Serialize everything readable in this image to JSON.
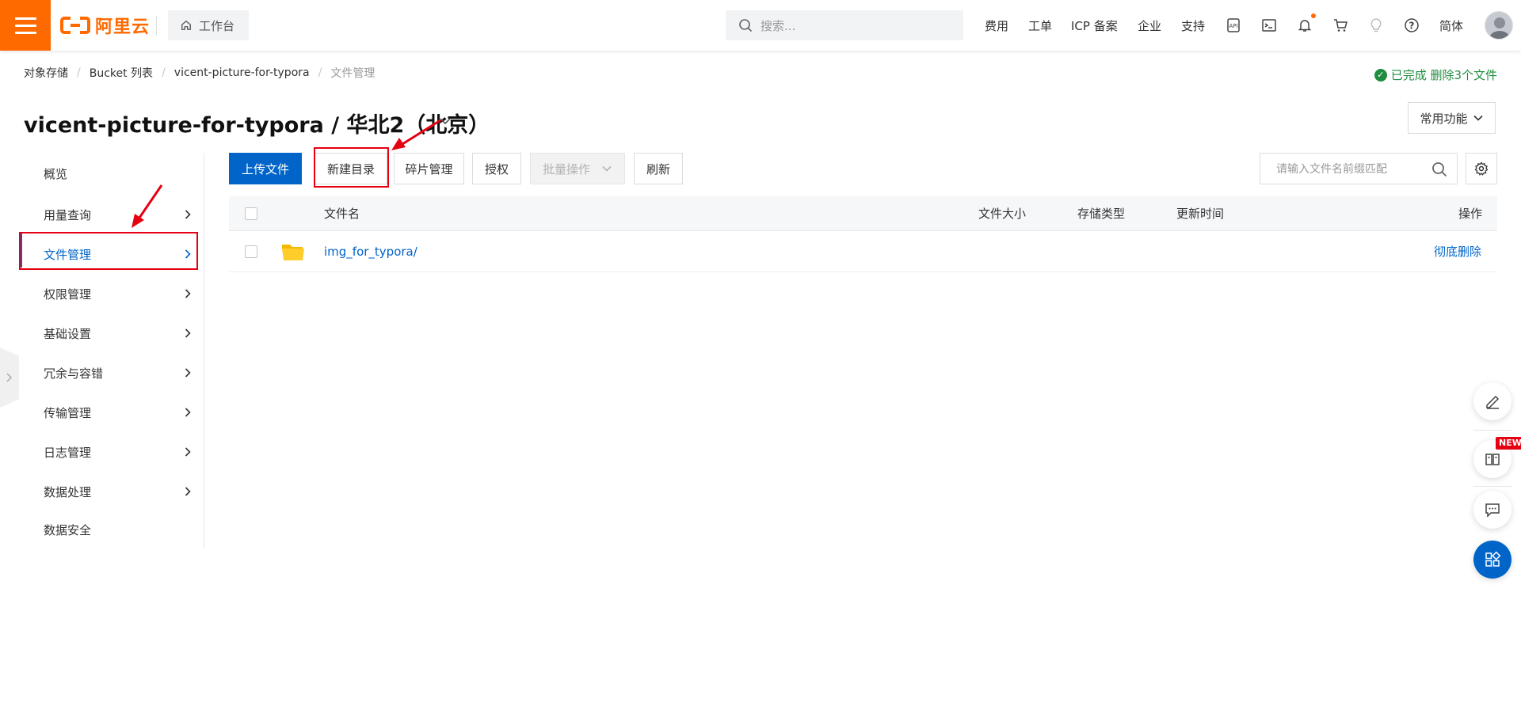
{
  "topbar": {
    "logo_text": "阿里云",
    "workbench_label": "工作台",
    "search_placeholder": "搜索...",
    "nav_links": [
      "费用",
      "工单",
      "ICP 备案",
      "企业",
      "支持"
    ],
    "lang_label": "简体",
    "icons": [
      "api-icon",
      "terminal-icon",
      "bell-icon",
      "cart-icon",
      "lightbulb-icon",
      "help-icon"
    ]
  },
  "breadcrumb": [
    "对象存储",
    "Bucket 列表",
    "vicent-picture-for-typora",
    "文件管理"
  ],
  "status": "已完成 删除3个文件",
  "page_title": "vicent-picture-for-typora / 华北2（北京）",
  "common_functions_label": "常用功能",
  "sidebar": {
    "items": [
      {
        "label": "概览"
      },
      {
        "label": "用量查询"
      },
      {
        "label": "文件管理"
      },
      {
        "label": "权限管理"
      },
      {
        "label": "基础设置"
      },
      {
        "label": "冗余与容错"
      },
      {
        "label": "传输管理"
      },
      {
        "label": "日志管理"
      },
      {
        "label": "数据处理"
      },
      {
        "label": "数据安全"
      }
    ]
  },
  "toolbar": {
    "upload_label": "上传文件",
    "new_dir_label": "新建目录",
    "fragments_label": "碎片管理",
    "authorize_label": "授权",
    "batch_label": "批量操作",
    "refresh_label": "刷新",
    "filter_placeholder": "请输入文件名前缀匹配"
  },
  "table": {
    "columns": {
      "name": "文件名",
      "size": "文件大小",
      "storage": "存储类型",
      "updated": "更新时间",
      "actions": "操作"
    },
    "rows": [
      {
        "name": "img_for_typora/",
        "size": "",
        "storage": "",
        "updated": "",
        "action": "彻底删除"
      }
    ]
  },
  "floating": {
    "new_badge": "NEW"
  },
  "colors": {
    "brand": "#ff6a00",
    "primary": "#0064c8",
    "success": "#1e8e3e",
    "annotation": "#e60012"
  }
}
